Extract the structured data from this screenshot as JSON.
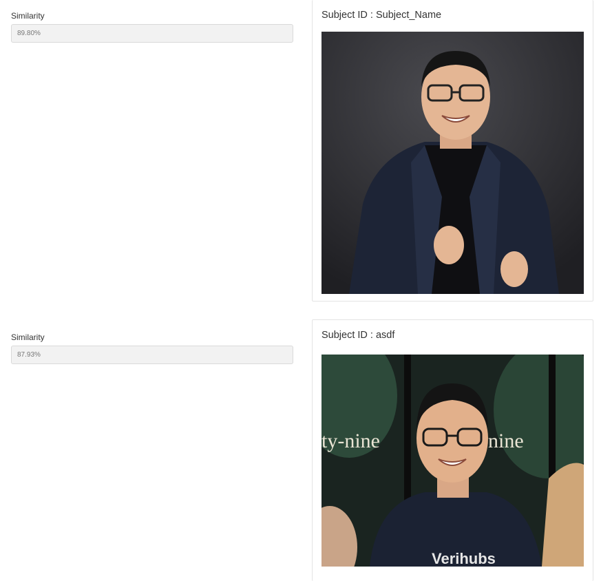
{
  "results": [
    {
      "similarity_label": "Similarity",
      "similarity_value": "89.80%",
      "subject_prefix": "Subject ID : ",
      "subject_id": "Subject_Name",
      "photo": "portrait-man-dark-blazer"
    },
    {
      "similarity_label": "Similarity",
      "similarity_value": "87.93%",
      "subject_prefix": "Subject ID : ",
      "subject_id": "asdf",
      "photo": "portrait-man-event-backdrop",
      "photo_text": {
        "left_sign": "ty-nine",
        "right_sign": "nine",
        "shirt_logo": "Verihubs"
      }
    }
  ]
}
